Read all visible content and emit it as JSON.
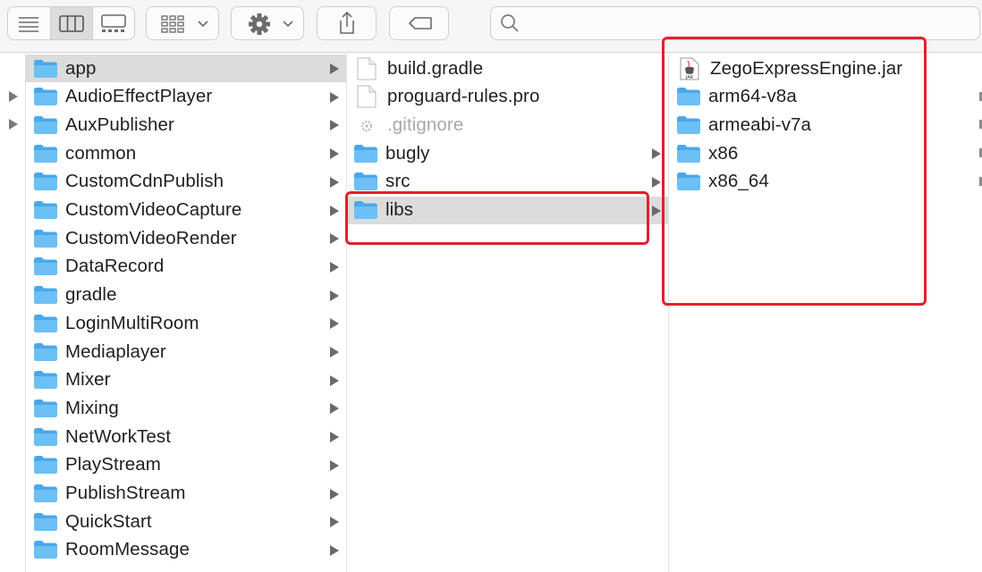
{
  "toolbar": {
    "view_buttons": [
      "list-view",
      "column-view",
      "gallery-view"
    ],
    "group_button": "group-by",
    "action_button": "action",
    "share_button": "share",
    "tag_button": "tags",
    "search": {
      "placeholder": ""
    }
  },
  "column1": {
    "items": [
      {
        "label": "app",
        "icon": "folder-icon",
        "selected": true
      },
      {
        "label": "AudioEffectPlayer",
        "icon": "folder-icon"
      },
      {
        "label": "AuxPublisher",
        "icon": "folder-icon"
      },
      {
        "label": "common",
        "icon": "folder-icon"
      },
      {
        "label": "CustomCdnPublish",
        "icon": "folder-icon"
      },
      {
        "label": "CustomVideoCapture",
        "icon": "folder-icon"
      },
      {
        "label": "CustomVideoRender",
        "icon": "folder-icon"
      },
      {
        "label": "DataRecord",
        "icon": "folder-icon"
      },
      {
        "label": "gradle",
        "icon": "folder-icon"
      },
      {
        "label": "LoginMultiRoom",
        "icon": "folder-icon"
      },
      {
        "label": "Mediaplayer",
        "icon": "folder-icon"
      },
      {
        "label": "Mixer",
        "icon": "folder-icon"
      },
      {
        "label": "Mixing",
        "icon": "folder-icon"
      },
      {
        "label": "NetWorkTest",
        "icon": "folder-icon"
      },
      {
        "label": "PlayStream",
        "icon": "folder-icon"
      },
      {
        "label": "PublishStream",
        "icon": "folder-icon"
      },
      {
        "label": "QuickStart",
        "icon": "folder-icon"
      },
      {
        "label": "RoomMessage",
        "icon": "folder-icon"
      }
    ]
  },
  "column2": {
    "items": [
      {
        "label": "build.gradle",
        "icon": "document-icon"
      },
      {
        "label": "proguard-rules.pro",
        "icon": "document-icon"
      },
      {
        "label": ".gitignore",
        "icon": "hidden-file-icon",
        "dimmed": true
      },
      {
        "label": "bugly",
        "icon": "folder-icon"
      },
      {
        "label": "src",
        "icon": "folder-icon"
      },
      {
        "label": "libs",
        "icon": "folder-icon",
        "selected": true
      }
    ]
  },
  "column3": {
    "items": [
      {
        "label": "ZegoExpressEngine.jar",
        "icon": "jar-file-icon"
      },
      {
        "label": "arm64-v8a",
        "icon": "folder-icon"
      },
      {
        "label": "armeabi-v7a",
        "icon": "folder-icon"
      },
      {
        "label": "x86",
        "icon": "folder-icon"
      },
      {
        "label": "x86_64",
        "icon": "folder-icon"
      }
    ]
  },
  "colors": {
    "folder": "#62b8f1",
    "selection": "#dcdcdc",
    "highlight": "#e3202c"
  }
}
